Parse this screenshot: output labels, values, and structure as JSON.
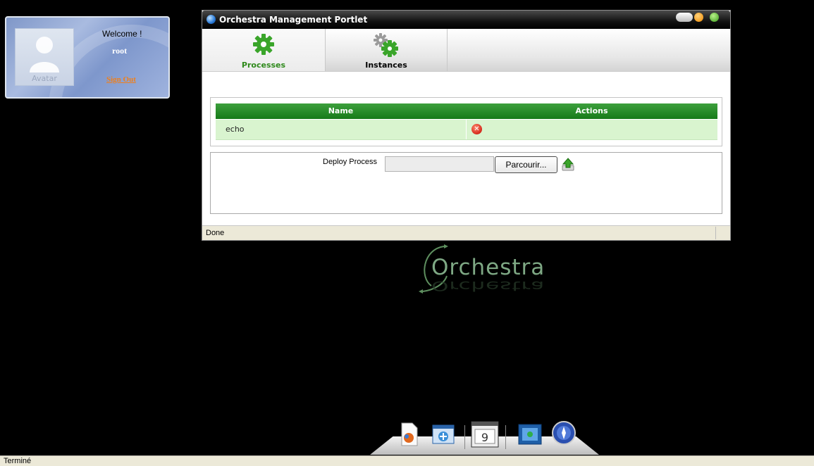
{
  "user_card": {
    "welcome": "Welcome !",
    "username": "root",
    "avatar_label": "Avatar",
    "sign_out": "Sign Out"
  },
  "window": {
    "title": "Orchestra Management Portlet",
    "tabs": [
      {
        "label": "Processes",
        "icon": "gear-icon",
        "active": true
      },
      {
        "label": "Instances",
        "icon": "gears-icon",
        "active": false
      }
    ],
    "grid": {
      "columns": [
        "Name",
        "Actions"
      ],
      "rows": [
        {
          "name": "echo",
          "action_icon": "delete-icon"
        }
      ]
    },
    "deploy": {
      "label": "Deploy Process",
      "file_value": "",
      "browse_label": "Parcourir...",
      "upload_icon": "upload-icon"
    },
    "status": "Done"
  },
  "logo": {
    "text": "Orchestra"
  },
  "dock": {
    "items": [
      "document-icon",
      "add-window-icon",
      "calendar-window-icon",
      "monitor-icon",
      "compass-icon"
    ]
  },
  "browser_status": "Terminé",
  "colors": {
    "accent_green": "#2f8a1c",
    "header_green": "#157a18",
    "row_green": "#d9f4cf",
    "sign_out_orange": "#f07f1a"
  }
}
